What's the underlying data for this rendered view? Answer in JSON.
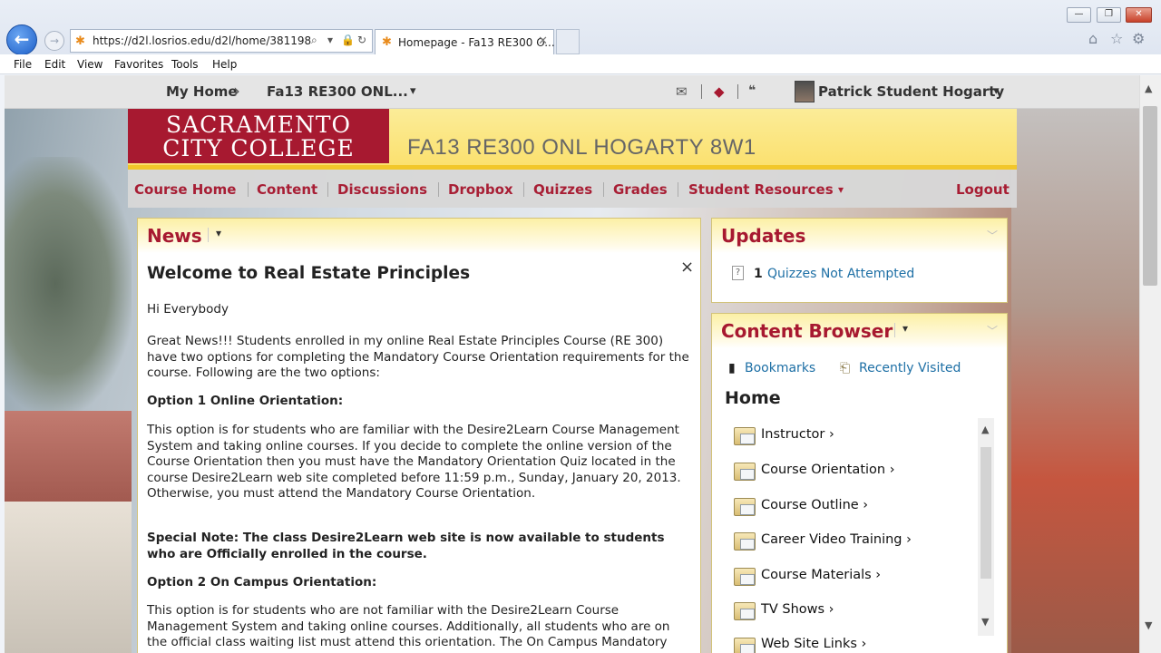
{
  "browser": {
    "url": "https://d2l.losrios.edu/d2l/home/381198",
    "tab_title": "Homepage - Fa13 RE300 O...",
    "menu": [
      "File",
      "Edit",
      "View",
      "Favorites",
      "Tools",
      "Help"
    ],
    "window_buttons": {
      "minimize": "—",
      "restore": "❐",
      "close": "✕"
    }
  },
  "d2l_nav": {
    "my_home": "My Home",
    "chevron": "›",
    "course_selector": "Fa13 RE300 ONL...",
    "dropdown_arrow": "▾",
    "user_name": "Patrick Student Hogarty"
  },
  "banner": {
    "logo_line1": "SACRAMENTO",
    "logo_line2": "CITY COLLEGE",
    "course_title": "FA13 RE300 ONL HOGARTY 8W1"
  },
  "course_nav": {
    "items": [
      "Course Home",
      "Content",
      "Discussions",
      "Dropbox",
      "Quizzes",
      "Grades",
      "Student Resources"
    ],
    "logout": "Logout"
  },
  "news": {
    "title": "News",
    "close": "×",
    "heading": "Welcome to Real Estate Principles",
    "greeting": "Hi Everybody",
    "para1": "Great News!!! Students enrolled in my online Real Estate Principles Course (RE 300) have two options for completing the Mandatory Course Orientation requirements for the course. Following are the two options:",
    "opt1_heading": "Option 1 Online Orientation:",
    "para2": "This option is for students who are familiar with the Desire2Learn Course Management System and taking online courses. If you decide to complete the online version of the Course Orientation then you must have the Mandatory Orientation Quiz located in the course Desire2Learn web site completed before 11:59 p.m., Sunday, January 20, 2013. Otherwise, you must attend the Mandatory Course Orientation.",
    "special_note": "Special Note:  The class Desire2Learn web site is now available to students who are Officially enrolled in the course.",
    "opt2_heading": "Option 2 On Campus Orientation:",
    "para3": "This option is for students who are not familiar with the Desire2Learn Course Management System and taking online courses. Additionally, all students who are on the official class waiting list must attend this orientation. The On Campus Mandatory"
  },
  "updates": {
    "title": "Updates",
    "count": "1",
    "label": "Quizzes Not Attempted"
  },
  "content_browser": {
    "title": "Content Browser",
    "bookmarks": "Bookmarks",
    "recently_visited": "Recently Visited",
    "home": "Home",
    "folders": [
      "Instructor",
      "Course Orientation",
      "Course Outline",
      "Career Video Training",
      "Course Materials",
      "TV Shows",
      "Web Site Links"
    ]
  },
  "colors": {
    "brand": "#a71930",
    "banner": "#fbe06c",
    "link": "#1d6fa5"
  }
}
